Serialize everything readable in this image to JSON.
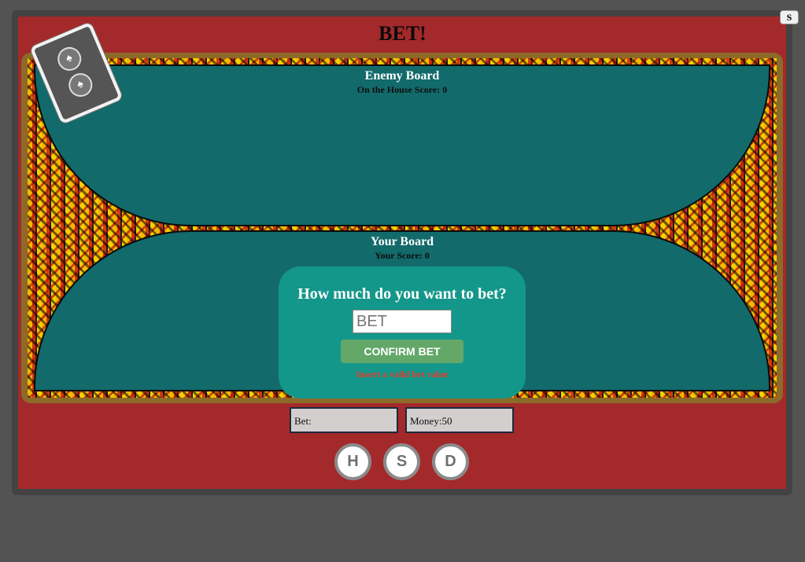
{
  "header": {
    "title": "BET!",
    "corner_button": "S"
  },
  "enemy_board": {
    "title": "Enemy Board",
    "score": "On the House Score: 0"
  },
  "your_board": {
    "title": "Your Board",
    "score": "Your Score: 0"
  },
  "bet_dialog": {
    "question": "How much do you want to bet?",
    "input_placeholder": "BET",
    "input_value": "",
    "confirm_label": "CONFIRM BET",
    "error": "Insert a valid bet value"
  },
  "stats": {
    "bet": "Bet:",
    "money": "Money:50"
  },
  "actions": {
    "hit": "H",
    "stand": "S",
    "double": "D"
  },
  "colors": {
    "table": "#a4292a",
    "felt": "#126a6b",
    "dialog": "#13978a",
    "confirm": "#63a869",
    "error": "#e53a2a"
  },
  "icons": {
    "deck": "card-back-icon"
  }
}
